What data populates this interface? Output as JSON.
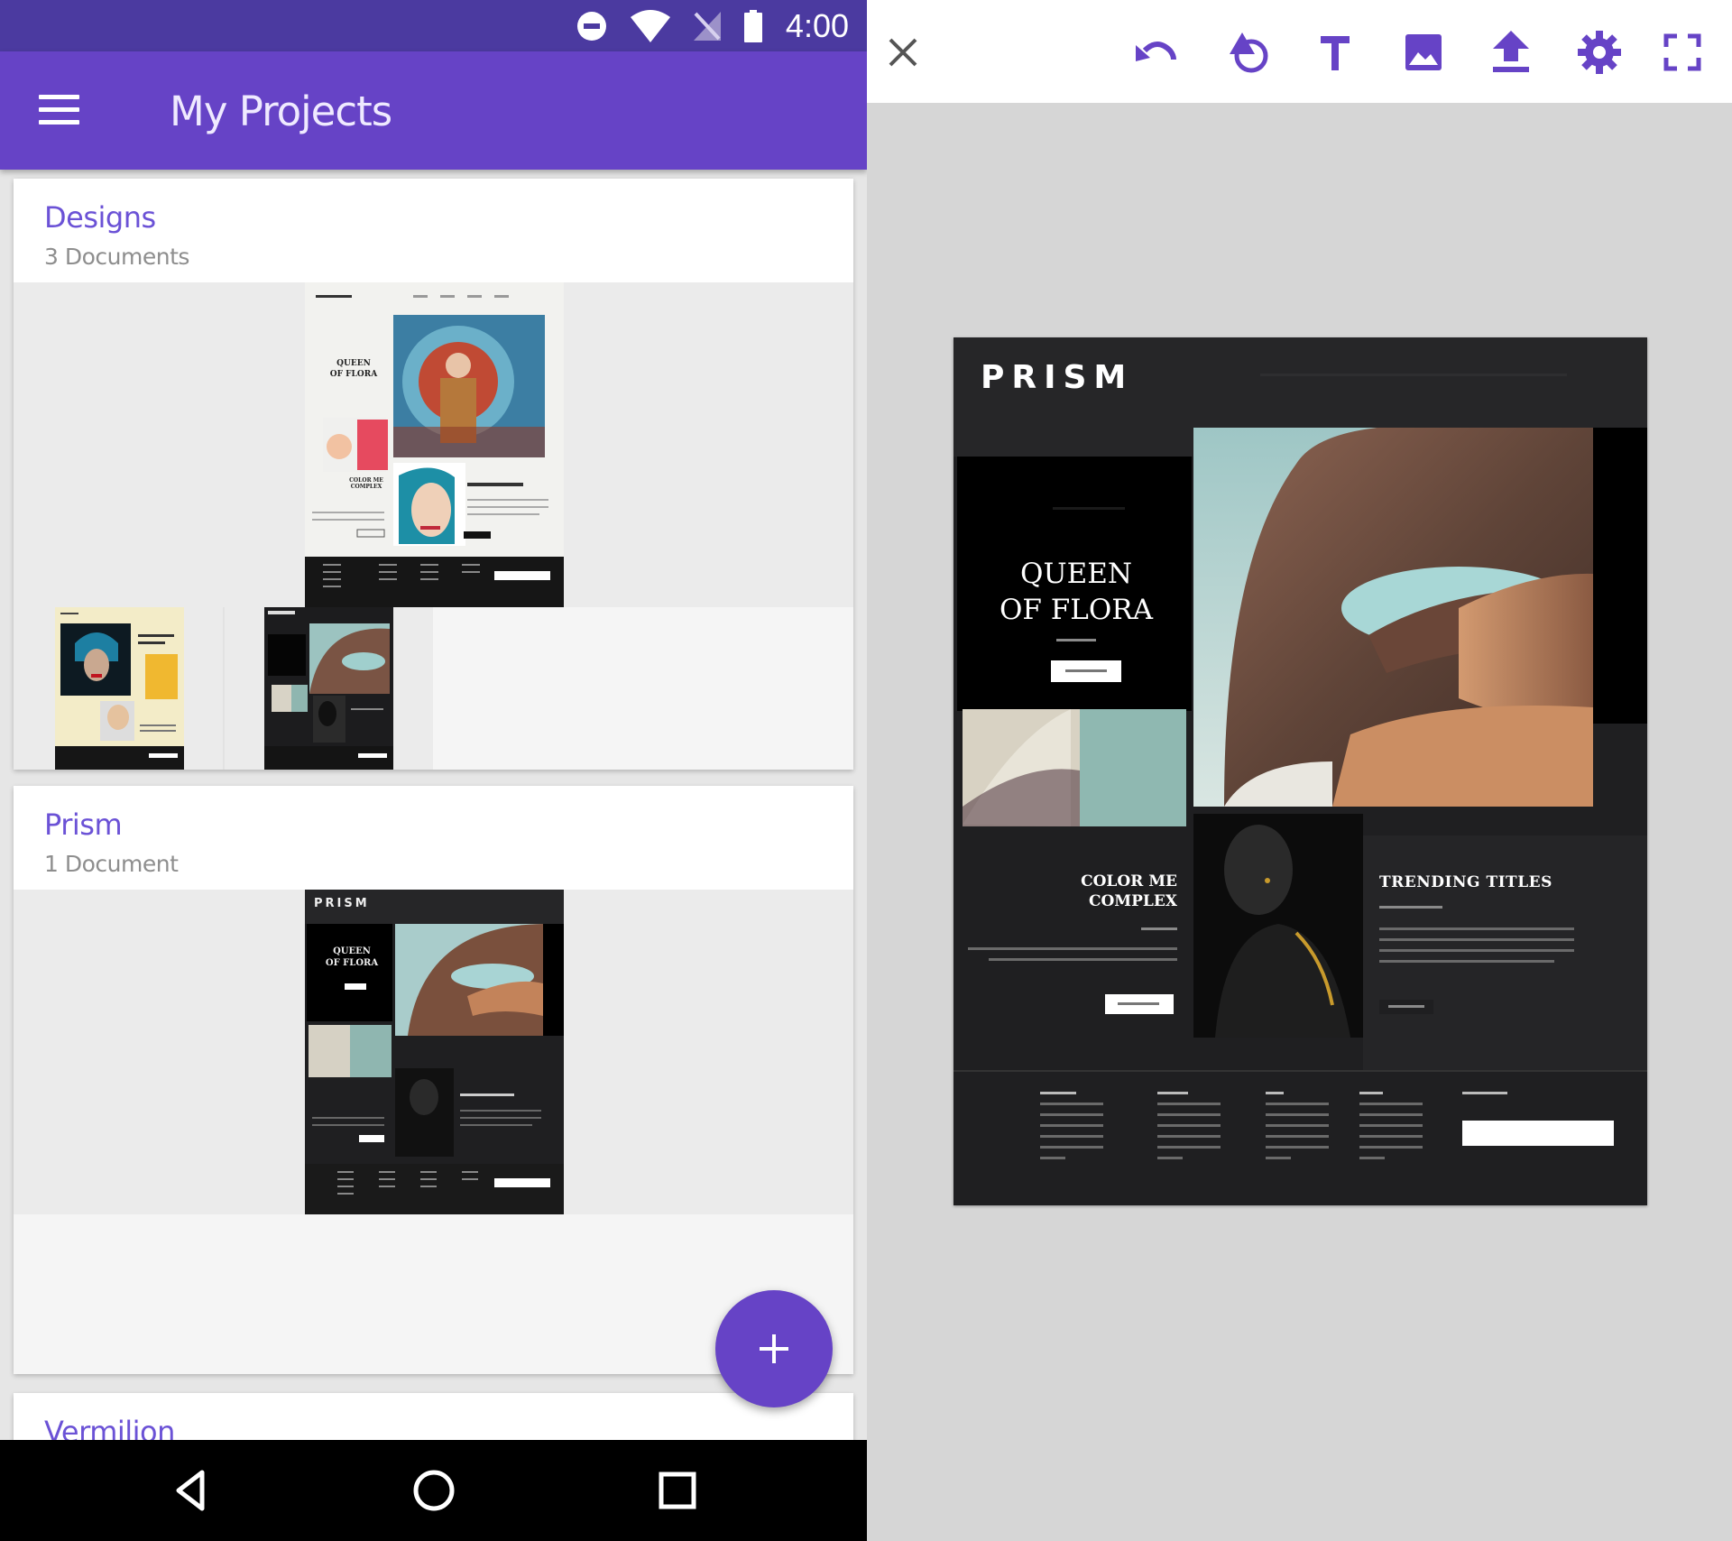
{
  "status_bar": {
    "time": "4:00"
  },
  "app_bar": {
    "title": "My Projects",
    "menu_icon": "hamburger-menu-icon"
  },
  "projects": [
    {
      "name": "Designs",
      "doc_count": "3 Documents"
    },
    {
      "name": "Prism",
      "doc_count": "1 Document"
    },
    {
      "name": "Vermilion"
    }
  ],
  "fab": {
    "label": "+"
  },
  "nav": {
    "icons": [
      "back-icon",
      "home-icon",
      "recents-icon"
    ]
  },
  "toolbar": {
    "icons": [
      "close-icon",
      "undo-icon",
      "shape-icon",
      "text-icon",
      "image-icon",
      "upload-icon",
      "settings-icon",
      "fullscreen-icon"
    ]
  },
  "document": {
    "brand": "PRISM",
    "hero_title_line1": "QUEEN",
    "hero_title_line2": "OF FLORA",
    "feature2_line1": "COLOR ME",
    "feature2_line2": "COMPLEX",
    "feature3_title": "TRENDING TITLES"
  },
  "thumb": {
    "designs_hero_line1": "QUEEN",
    "designs_hero_line2": "OF FLORA",
    "designs_feature2_line1": "COLOR ME",
    "designs_feature2_line2": "COMPLEX",
    "prism_brand": "PRISM",
    "prism_hero_line1": "QUEEN",
    "prism_hero_line2": "OF FLORA"
  },
  "colors": {
    "status_bar": "#4b3aa0",
    "app_bar": "#6643c6",
    "accent": "#6b52d6",
    "editor_canvas_bg": "#d6d6d6",
    "document_bg": "#1f1f21"
  }
}
